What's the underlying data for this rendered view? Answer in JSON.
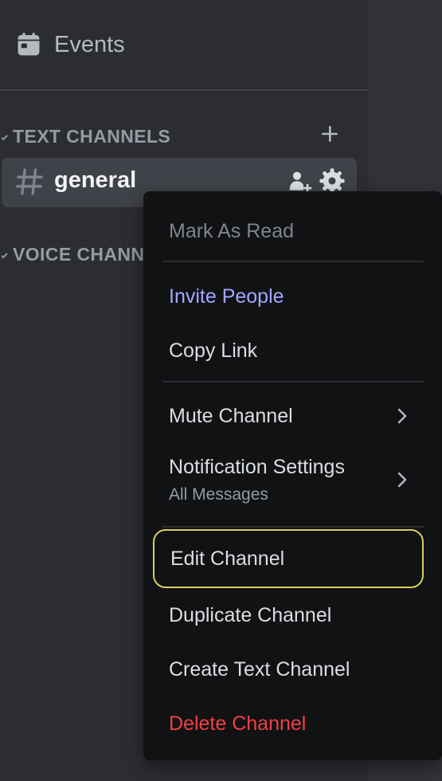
{
  "sidebar": {
    "events_label": "Events",
    "categories": [
      {
        "name": "TEXT CHANNELS"
      },
      {
        "name": "VOICE CHANNELS"
      }
    ],
    "channels": [
      {
        "name": "general"
      }
    ]
  },
  "context_menu": {
    "items": {
      "mark_as_read": "Mark As Read",
      "invite_people": "Invite People",
      "copy_link": "Copy Link",
      "mute_channel": "Mute Channel",
      "notification_settings": "Notification Settings",
      "notification_settings_value": "All Messages",
      "edit_channel": "Edit Channel",
      "duplicate_channel": "Duplicate Channel",
      "create_text_channel": "Create Text Channel",
      "delete_channel": "Delete Channel"
    }
  },
  "icons": {
    "events": "calendar-icon",
    "collapse": "chevron-down-icon",
    "add": "plus-icon",
    "channel": "hash-icon",
    "invite": "add-member-icon",
    "settings": "gear-icon",
    "submenu": "chevron-right-icon"
  },
  "colors": {
    "sidebar_bg": "#2b2d31",
    "menu_bg": "#111214",
    "selected_channel_bg": "#404249",
    "brand": "#a1a7ff",
    "danger": "#f23f43",
    "focus_outline": "#d8cf5e"
  }
}
